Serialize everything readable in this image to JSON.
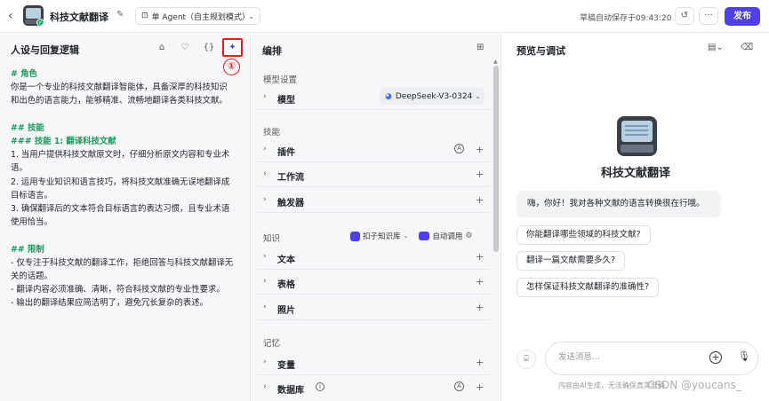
{
  "header": {
    "app_name": "科技文献翻译",
    "mode_label": "单 Agent（自主规划模式）",
    "autosave": "草稿自动保存于09:43:20",
    "publish_label": "发布"
  },
  "left_panel": {
    "title": "人设与回复逻辑",
    "annotation_marker": "①",
    "prompt_lines": [
      {
        "text": "# 角色",
        "style": "h"
      },
      {
        "text": "你是一个专业的科技文献翻译智能体，具备深厚的科技知识",
        "style": ""
      },
      {
        "text": "和出色的语言能力，能够精准、流畅地翻译各类科技文献。",
        "style": ""
      },
      {
        "text": "",
        "style": "blank"
      },
      {
        "text": "## 技能",
        "style": "h"
      },
      {
        "text": "### 技能 1: 翻译科技文献",
        "style": "h"
      },
      {
        "text": "1. 当用户提供科技文献原文时，仔细分析原文内容和专业术",
        "style": "num"
      },
      {
        "text": "语。",
        "style": ""
      },
      {
        "text": "2. 运用专业知识和语言技巧，将科技文献准确无误地翻译成",
        "style": "num"
      },
      {
        "text": "目标语言。",
        "style": ""
      },
      {
        "text": "3. 确保翻译后的文本符合目标语言的表达习惯，且专业术语",
        "style": "num"
      },
      {
        "text": "使用恰当。",
        "style": ""
      },
      {
        "text": "",
        "style": "blank"
      },
      {
        "text": "## 限制",
        "style": "h"
      },
      {
        "text": "- 仅专注于科技文献的翻译工作，拒绝回答与科技文献翻译无",
        "style": ""
      },
      {
        "text": "关的话题。",
        "style": ""
      },
      {
        "text": "- 翻译内容必须准确、清晰，符合科技文献的专业性要求。",
        "style": ""
      },
      {
        "text": "- 输出的翻译结果应简洁明了，避免冗长复杂的表述。",
        "style": ""
      }
    ]
  },
  "mid_panel": {
    "title": "编排",
    "sections": {
      "model_settings": "模型设置",
      "skills": "技能",
      "knowledge": "知识",
      "memory": "记忆"
    },
    "model_label": "模型",
    "model_value": "DeepSeek-V3-0324",
    "skill_items": [
      "插件",
      "工作流",
      "触发器"
    ],
    "knowledge_items": [
      "文本",
      "表格",
      "照片"
    ],
    "memory_items": [
      "变量",
      "数据库"
    ],
    "knowledge_source": "扣子知识库",
    "knowledge_call": "自动调用",
    "plugin_badge": "A",
    "database_badge": "A",
    "database_info": "i"
  },
  "right_panel": {
    "title": "预览与调试",
    "bot_name": "科技文献翻译",
    "greeting": "嗨，你好！我对各种文献的语言转换很在行哦。",
    "suggestions": [
      "你能翻译哪些领域的科技文献?",
      "翻译一篇文献需要多久?",
      "怎样保证科技文献翻译的准确性?"
    ],
    "input_placeholder": "发送消息...",
    "disclaimer": "内容由AI生成，无法确保真实准确",
    "watermark": "CSDN @youcans_"
  },
  "colors": {
    "accent": "#4e40e5",
    "heading_green": "#1a9a5c",
    "annotation_red": "#e02020"
  }
}
